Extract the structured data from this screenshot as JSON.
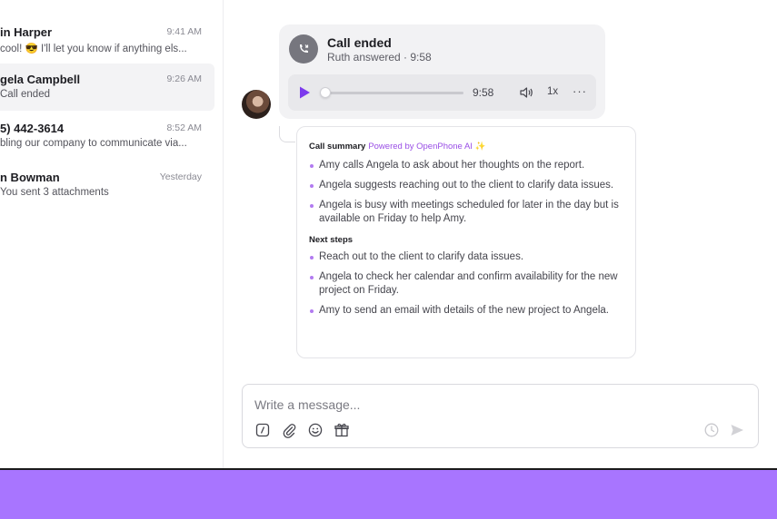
{
  "conversations": [
    {
      "name": "in Harper",
      "time": "9:41 AM",
      "preview": "cool! 😎 I'll let you know if anything els..."
    },
    {
      "name": "gela Campbell",
      "time": "9:26 AM",
      "preview": "Call ended"
    },
    {
      "name": "5) 442-3614",
      "time": "8:52 AM",
      "preview": "bling our company to communicate via..."
    },
    {
      "name": "n Bowman",
      "time": "Yesterday",
      "preview": "You sent 3 attachments"
    }
  ],
  "call": {
    "title": "Call ended",
    "subtitle": "Ruth answered · 9:58",
    "duration": "9:58",
    "speed": "1x",
    "more": "···",
    "progress": 0.0
  },
  "summary": {
    "heading": "Call summary",
    "powered": "Powered by OpenPhone AI ✨",
    "points": [
      "Amy calls Angela to ask about her thoughts on the report.",
      "Angela suggests reaching out to the client to clarify data issues.",
      "Angela is busy with meetings scheduled for later in the day but is available on Friday to help Amy."
    ],
    "next_steps_heading": "Next steps",
    "next_steps": [
      "Reach out to the client to clarify data issues.",
      "Angela to check her calendar and confirm availability for the new project on Friday.",
      "Amy to send an email with details of the new project to Angela."
    ]
  },
  "composer": {
    "placeholder": "Write a message...",
    "icons": [
      "shortcut-icon",
      "attachment-icon",
      "emoji-icon",
      "gift-icon",
      "schedule-icon",
      "send-icon"
    ]
  },
  "colors": {
    "accent": "#7c3aed",
    "band": "#a875ff",
    "ai": "#9a4fe6"
  }
}
